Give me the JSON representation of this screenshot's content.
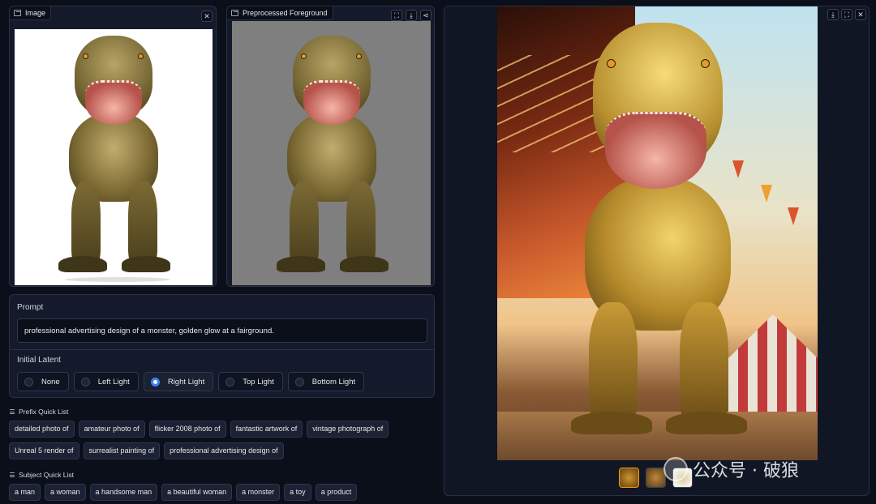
{
  "image_panel": {
    "label": "Image",
    "icon": "image-icon",
    "close_label": "✕"
  },
  "fg_panel": {
    "label": "Preprocessed Foreground",
    "icon": "image-icon"
  },
  "output_panel": {
    "buttons": [
      "download-icon",
      "fullscreen-icon",
      "close-icon"
    ]
  },
  "prompt": {
    "title": "Prompt",
    "value": "professional advertising design of a monster, golden glow at a fairground."
  },
  "latent": {
    "title": "Initial Latent",
    "options": [
      "None",
      "Left Light",
      "Right Light",
      "Top Light",
      "Bottom Light"
    ],
    "selected": "Right Light"
  },
  "prefix_quick_list": {
    "title": "Prefix Quick List",
    "row1": [
      "detailed photo of",
      "amateur photo of",
      "flicker 2008 photo of",
      "fantastic artwork of",
      "vintage photograph of"
    ],
    "row2": [
      "Unreal 5 render of",
      "surrealist painting of",
      "professional advertising design of"
    ]
  },
  "subject_quick_list": {
    "title": "Subject Quick List",
    "items": [
      "a man",
      "a woman",
      "a handsome man",
      "a beautiful woman",
      "a monster",
      "a toy",
      "a product"
    ]
  },
  "watermark": {
    "text": "公众号 · 破狼"
  },
  "colors": {
    "accent": "#3b82f6",
    "background": "#0b0f19",
    "panel": "#141a2b"
  }
}
